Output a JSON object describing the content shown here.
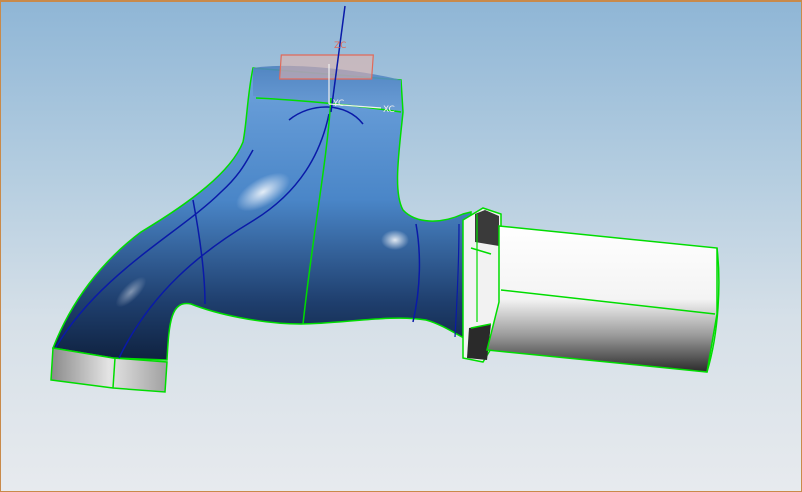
{
  "viewport": {
    "border_color": "#c98a4a",
    "background_top": "#8fb6d6",
    "background_bottom": "#e7eaee"
  },
  "model": {
    "body_color": "#4a86c8",
    "edge_color": "#00dd00",
    "curve_color": "#0a1aa8",
    "pipe_color": "#ffffff"
  },
  "wcs": {
    "xc_label": "XC",
    "zc_label": "ZC",
    "yc_label": "YC",
    "axis_color": "#f0f0f0",
    "marker_color": "#e06a5a"
  }
}
